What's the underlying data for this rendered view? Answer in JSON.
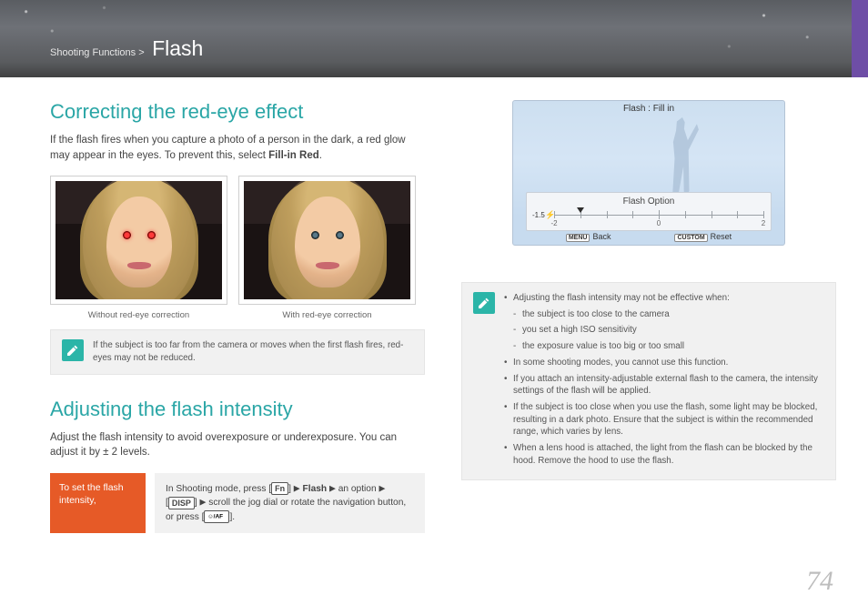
{
  "header": {
    "breadcrumb_prefix": "Shooting Functions >",
    "breadcrumb_title": "Flash"
  },
  "left": {
    "sec1_title": "Correcting the red-eye effect",
    "sec1_para_a": "If the flash fires when you capture a photo of a person in the dark, a red glow may appear in the eyes. To prevent this, select ",
    "sec1_para_bold": "Fill-in Red",
    "sec1_para_b": ".",
    "caption_without": "Without red-eye correction",
    "caption_with": "With red-eye correction",
    "note1": "If the subject is too far from the camera or moves when the first flash fires, red-eyes may not be reduced.",
    "sec2_title": "Adjusting the flash intensity",
    "sec2_para": "Adjust the flash intensity to avoid overexposure or underexposure. You can adjust it by ± 2 levels.",
    "red_label": "To set the flash intensity,",
    "instr_a": "In Shooting mode, press [",
    "instr_fn": "Fn",
    "instr_b": "] ",
    "instr_arrow": "▶",
    "instr_flash": " Flash ",
    "instr_c": " an option ",
    "instr_d": "[",
    "instr_disp": "DISP",
    "instr_e": "] ",
    "instr_f": " scroll the jog dial or rotate the navigation button, or press [",
    "instr_af": "",
    "instr_g": "]."
  },
  "cam": {
    "title": "Flash : Fill in",
    "option_label": "Flash Option",
    "value": "-1.5",
    "tick_neg2": "-2",
    "tick_0": "0",
    "tick_2": "2",
    "menu_pill": "MENU",
    "back": "Back",
    "custom_pill": "CUSTOM",
    "reset": "Reset"
  },
  "right_note": {
    "b1": "Adjusting the flash intensity may not be effective when:",
    "s1": "the subject is too close to the camera",
    "s2": "you set a high ISO sensitivity",
    "s3": "the exposure value is too big or too small",
    "b2": "In some shooting modes, you cannot use this function.",
    "b3": "If you attach an intensity-adjustable external flash to the camera, the intensity settings of the flash will be applied.",
    "b4": "If the subject is too close when you use the flash, some light may be blocked, resulting in a dark photo. Ensure that the subject is within the recommended range, which varies by lens.",
    "b5": "When a lens hood is attached, the light from the flash can be blocked by the hood. Remove the hood to use the flash."
  },
  "page_number": "74",
  "icons": {
    "pencil": "pencil-icon"
  }
}
